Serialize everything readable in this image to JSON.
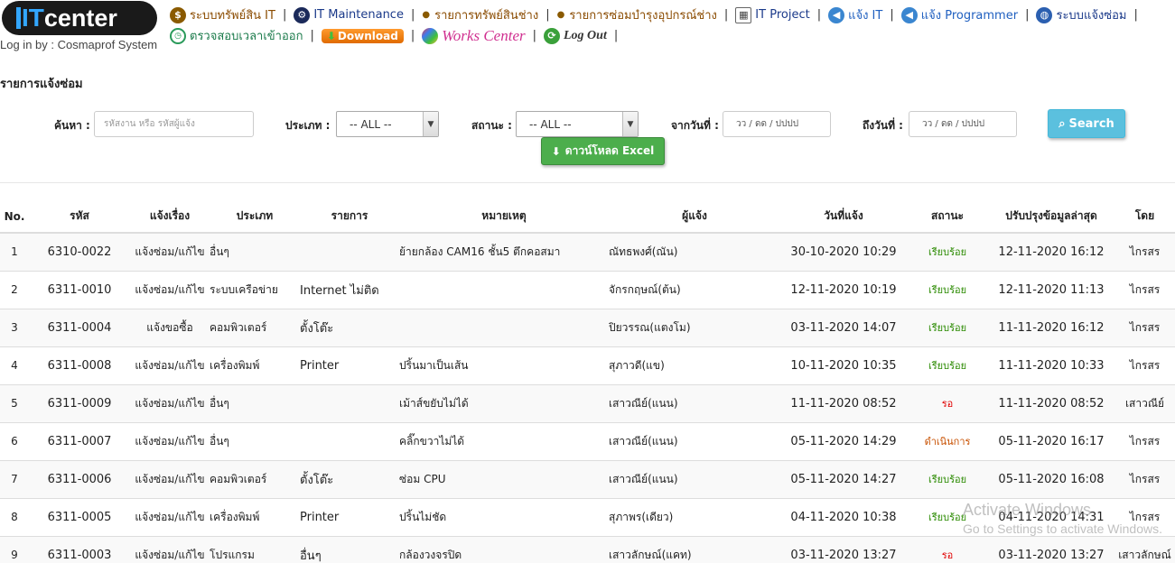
{
  "header": {
    "logo_it": "IT",
    "logo_center": "center",
    "login_text": "Log in by : Cosmaprof System"
  },
  "nav_row1": [
    {
      "label": "ระบบทรัพย์สิน IT",
      "icon": "money-bag-icon"
    },
    {
      "label": "IT Maintenance",
      "icon": "maintenance-icon"
    },
    {
      "label": "รายการทรัพย์สินช่าง",
      "icon": "bullet-icon"
    },
    {
      "label": "รายการซ่อมบำรุงอุปกรณ์ช่าง",
      "icon": "bullet-icon"
    },
    {
      "label": "IT Project",
      "icon": "calendar-icon"
    },
    {
      "label": "แจ้ง IT",
      "icon": "megaphone-icon"
    },
    {
      "label": "แจ้ง Programmer",
      "icon": "megaphone-icon"
    },
    {
      "label": "ระบบแจ้งซ่อม",
      "icon": "globe-icon"
    }
  ],
  "nav_row2": [
    {
      "label": "ตรวจสอบเวลาเข้าออก",
      "icon": "clock-icon"
    },
    {
      "label": "Download",
      "icon": "download-icon"
    },
    {
      "label": "Works Center",
      "icon": "works-icon"
    },
    {
      "label": "Log Out",
      "icon": "logout-icon"
    }
  ],
  "page_title": "รายการแจ้งซ่อม",
  "filters": {
    "search_label": "ค้นหา :",
    "search_placeholder": "รหัสงาน หรือ รหัสผู้แจ้ง",
    "type_label": "ประเภท :",
    "type_value": "-- ALL --",
    "status_label": "สถานะ :",
    "status_value": "-- ALL --",
    "from_label": "จากวันที่ :",
    "from_placeholder": "วว / ดด / ปปปป",
    "to_label": "ถึงวันที่ :",
    "to_placeholder": "วว / ดด / ปปปป",
    "search_button": "Search",
    "excel_button": "ดาวน์โหลด Excel"
  },
  "table": {
    "headers": [
      "No.",
      "รหัส",
      "แจ้งเรื่อง",
      "ประเภท",
      "รายการ",
      "หมายเหตุ",
      "ผู้แจ้ง",
      "วันที่แจ้ง",
      "สถานะ",
      "ปรับปรุงข้อมูลล่าสุด",
      "โดย"
    ],
    "rows": [
      {
        "no": "1",
        "code": "6310-0022",
        "subject": "แจ้งซ่อม/แก้ไข",
        "type": "อื่นๆ",
        "item": "",
        "note": "ย้ายกล้อง CAM16 ชั้น5 ตึกคอสมา",
        "reporter": "ณัทธพงศ์(ณัน)",
        "date": "30-10-2020 10:29",
        "status": "เรียบร้อย",
        "status_kind": "ok",
        "updated": "12-11-2020 16:12",
        "by": "ไกรสร"
      },
      {
        "no": "2",
        "code": "6311-0010",
        "subject": "แจ้งซ่อม/แก้ไข",
        "type": "ระบบเครือข่าย",
        "item": "Internet ไม่ติด",
        "note": "",
        "reporter": "จักรกฤษณ์(ต้น)",
        "date": "12-11-2020 10:19",
        "status": "เรียบร้อย",
        "status_kind": "ok",
        "updated": "12-11-2020 11:13",
        "by": "ไกรสร"
      },
      {
        "no": "3",
        "code": "6311-0004",
        "subject": "แจ้งขอซื้อ",
        "type": "คอมพิวเตอร์",
        "item": "ตั้งโต๊ะ",
        "note": "",
        "reporter": "ปิยวรรณ(แตงโม)",
        "date": "03-11-2020 14:07",
        "status": "เรียบร้อย",
        "status_kind": "ok",
        "updated": "11-11-2020 16:12",
        "by": "ไกรสร"
      },
      {
        "no": "4",
        "code": "6311-0008",
        "subject": "แจ้งซ่อม/แก้ไข",
        "type": "เครื่องพิมพ์",
        "item": "Printer",
        "note": "ปริ้นมาเป็นเส้น",
        "reporter": "สุภาวดี(แข)",
        "date": "10-11-2020 10:35",
        "status": "เรียบร้อย",
        "status_kind": "ok",
        "updated": "11-11-2020 10:33",
        "by": "ไกรสร"
      },
      {
        "no": "5",
        "code": "6311-0009",
        "subject": "แจ้งซ่อม/แก้ไข",
        "type": "อื่นๆ",
        "item": "",
        "note": "เม้าส์ขยับไม่ได้",
        "reporter": "เสาวณีย์(แนน)",
        "date": "11-11-2020 08:52",
        "status": "รอ",
        "status_kind": "wait",
        "updated": "11-11-2020 08:52",
        "by": "เสาวณีย์"
      },
      {
        "no": "6",
        "code": "6311-0007",
        "subject": "แจ้งซ่อม/แก้ไข",
        "type": "อื่นๆ",
        "item": "",
        "note": "คลิ๊กขวาไม่ได้",
        "reporter": "เสาวณีย์(แนน)",
        "date": "05-11-2020 14:29",
        "status": "ดำเนินการ",
        "status_kind": "prog",
        "updated": "05-11-2020 16:17",
        "by": "ไกรสร"
      },
      {
        "no": "7",
        "code": "6311-0006",
        "subject": "แจ้งซ่อม/แก้ไข",
        "type": "คอมพิวเตอร์",
        "item": "ตั้งโต๊ะ",
        "note": "ซ่อม CPU",
        "reporter": "เสาวณีย์(แนน)",
        "date": "05-11-2020 14:27",
        "status": "เรียบร้อย",
        "status_kind": "ok",
        "updated": "05-11-2020 16:08",
        "by": "ไกรสร"
      },
      {
        "no": "8",
        "code": "6311-0005",
        "subject": "แจ้งซ่อม/แก้ไข",
        "type": "เครื่องพิมพ์",
        "item": "Printer",
        "note": "ปริ้นไม่ชัด",
        "reporter": "สุภาพร(เดียว)",
        "date": "04-11-2020 10:38",
        "status": "เรียบร้อย",
        "status_kind": "ok",
        "updated": "04-11-2020 14:31",
        "by": "ไกรสร"
      },
      {
        "no": "9",
        "code": "6311-0003",
        "subject": "แจ้งซ่อม/แก้ไข",
        "type": "โปรแกรม",
        "item": "อื่นๆ",
        "note": "กล้องวงจรปิด",
        "reporter": "เสาวลักษณ์(แคท)",
        "date": "03-11-2020 13:27",
        "status": "รอ",
        "status_kind": "wait",
        "updated": "03-11-2020 13:27",
        "by": "เสาวลักษณ์"
      }
    ]
  },
  "watermark": {
    "line1": "Activate Windows",
    "line2": "Go to Settings to activate Windows."
  },
  "colors": {
    "status_ok": "#2a8a00",
    "status_wait": "#e00000",
    "status_progress": "#c85000",
    "search_button": "#5bc0de",
    "excel_button": "#4cae4c"
  }
}
